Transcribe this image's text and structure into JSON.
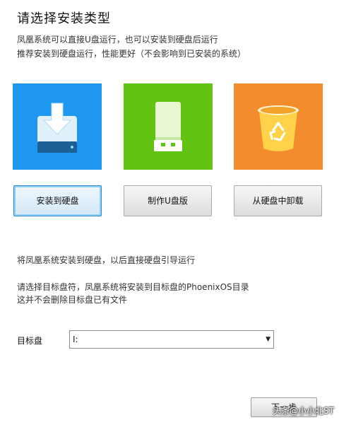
{
  "header": {
    "title": "请选择安装类型",
    "desc_line1": "凤凰系统可以直接U盘运行，也可以安装到硬盘后运行",
    "desc_line2": "推荐安装到硬盘运行，性能更好（不会影响到已安装的系统）"
  },
  "options": [
    {
      "label": "安装到硬盘",
      "icon": "hard-disk-install-icon",
      "color": "#1e97ef"
    },
    {
      "label": "制作U盘版",
      "icon": "usb-drive-icon",
      "color": "#62c312"
    },
    {
      "label": "从硬盘中卸载",
      "icon": "recycle-bin-icon",
      "color": "#f28c2c"
    }
  ],
  "info": {
    "line1": "将凤凰系统安装到硬盘，以后直接硬盘引导运行",
    "line2": "请选择目标盘符，凤凰系统将安装到目标盘的PhoenixOS目录",
    "line3": "这并不会删除目标盘已有文件"
  },
  "target": {
    "label": "目标盘",
    "selected": "I:"
  },
  "footer": {
    "next_label": "下一步"
  },
  "watermark": "头条@小小北ST"
}
